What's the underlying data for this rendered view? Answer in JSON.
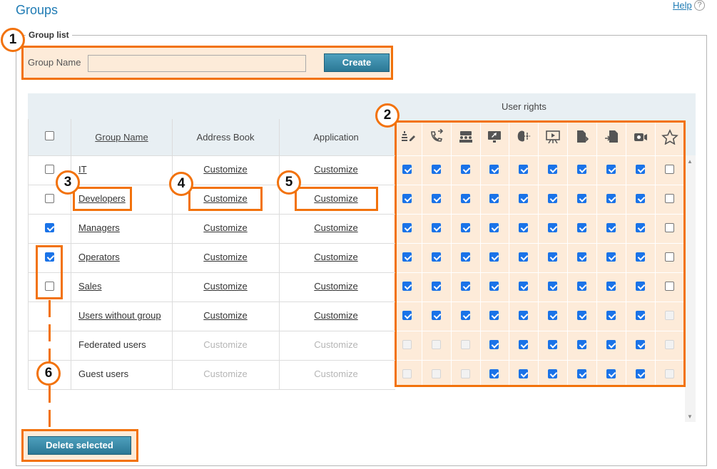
{
  "header": {
    "title": "Groups",
    "help_label": "Help",
    "help_icon": "?"
  },
  "group_list": {
    "legend": "Group list",
    "group_name_label": "Group Name",
    "group_name_value": "",
    "create_label": "Create"
  },
  "table": {
    "user_rights_label": "User rights",
    "columns": {
      "group_name": "Group Name",
      "address_book": "Address Book",
      "application": "Application"
    },
    "right_icons": [
      "edit-list-icon",
      "call-transfer-icon",
      "conference-icon",
      "screen-share-icon",
      "remote-control-icon",
      "presentation-icon",
      "file-send-icon",
      "file-receive-icon",
      "video-record-icon",
      "favorite-star-icon"
    ],
    "rows": [
      {
        "name": "IT",
        "ab": "Customize",
        "app": "Customize"
      },
      {
        "name": "Developers",
        "ab": "Customize",
        "app": "Customize"
      },
      {
        "name": "Managers",
        "ab": "Customize",
        "app": "Customize"
      },
      {
        "name": "Operators",
        "ab": "Customize",
        "app": "Customize"
      },
      {
        "name": "Sales",
        "ab": "Customize",
        "app": "Customize"
      },
      {
        "name": "Users without group",
        "ab": "Customize",
        "app": "Customize"
      },
      {
        "name": "Federated users",
        "ab": "Customize",
        "app": "Customize"
      },
      {
        "name": "Guest users",
        "ab": "Customize",
        "app": "Customize"
      }
    ]
  },
  "footer": {
    "delete_label": "Delete selected"
  },
  "callouts": [
    "1",
    "2",
    "3",
    "4",
    "5",
    "6"
  ],
  "colors": {
    "accent": "#f2720c",
    "highlight_fill": "#fdebd9",
    "title_blue": "#1f7bb4",
    "checkbox_blue": "#1a73e8"
  }
}
